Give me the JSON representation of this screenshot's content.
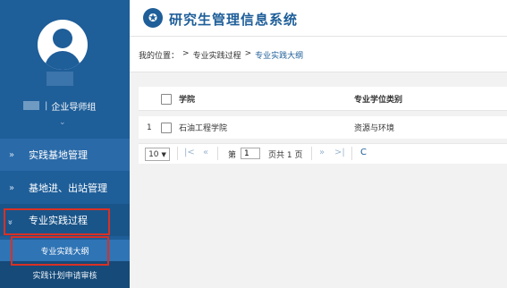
{
  "header": {
    "title": "研究生管理信息系统",
    "logo_icon": "university-seal-icon"
  },
  "user": {
    "role": "企业导师组",
    "separator": "|"
  },
  "breadcrumb": {
    "prefix": "我的位置：",
    "items": [
      "专业实践过程",
      "专业实践大纲"
    ],
    "separator": ">"
  },
  "sidebar": {
    "items": [
      {
        "label": "实践基地管理",
        "arrow": "»"
      },
      {
        "label": "基地进、出站管理",
        "arrow": "»"
      },
      {
        "label": "专业实践过程",
        "arrow": "»"
      }
    ],
    "subitems": [
      {
        "label": "专业实践大纲"
      },
      {
        "label": "实践计划申请审核"
      }
    ],
    "expand_glyph": "⌄"
  },
  "table": {
    "columns": [
      "学院",
      "专业学位类别"
    ],
    "rows": [
      {
        "index": "1",
        "college": "石油工程学院",
        "category": "资源与环境"
      }
    ]
  },
  "pager": {
    "page_size": "10",
    "first": "|<",
    "prev": "«",
    "page_label": "第",
    "page_value": "1",
    "page_total": "页共 1 页",
    "next": "»",
    "last": ">|",
    "refresh": "C"
  },
  "colors": {
    "sidebar": "#1e5e99",
    "accent": "#1e5e99",
    "highlight": "#d93025"
  }
}
